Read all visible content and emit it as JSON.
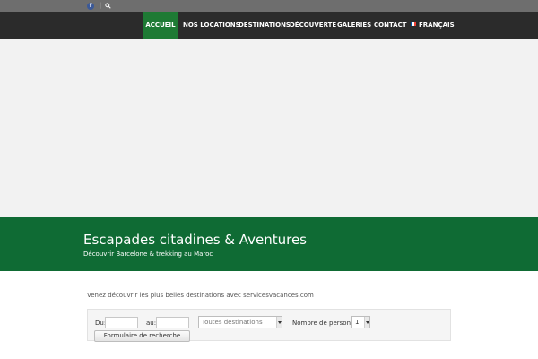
{
  "topbar": {
    "facebook_glyph": "f",
    "separator": "|"
  },
  "nav": {
    "items": [
      {
        "label": "ACCUEIL",
        "active": true
      },
      {
        "label": "NOS LOCATIONS"
      },
      {
        "label": "DESTINATIONS"
      },
      {
        "label": "DÉCOUVERTE"
      },
      {
        "label": "GALERIES"
      },
      {
        "label": "CONTACT"
      },
      {
        "label": "FRANÇAIS"
      }
    ]
  },
  "banner": {
    "title": "Escapades citadines & Aventures",
    "subtitle": "Découvrir Barcelone & trekking au Maroc"
  },
  "intro": "Venez découvrir les plus belles destinations  avec servicesvacances.com",
  "search_form": {
    "from_label": "Du:",
    "to_label": "au:",
    "destination_selected": "Toutes destinations",
    "persons_label": "Nombre de personnes:",
    "persons_selected": "1",
    "submit_label": "Formulaire de recherche"
  },
  "colors": {
    "nav_active": "#1e7a34",
    "banner": "#0f6b34",
    "navbar": "#2b2b2b",
    "topbar": "#6e6e6e"
  }
}
